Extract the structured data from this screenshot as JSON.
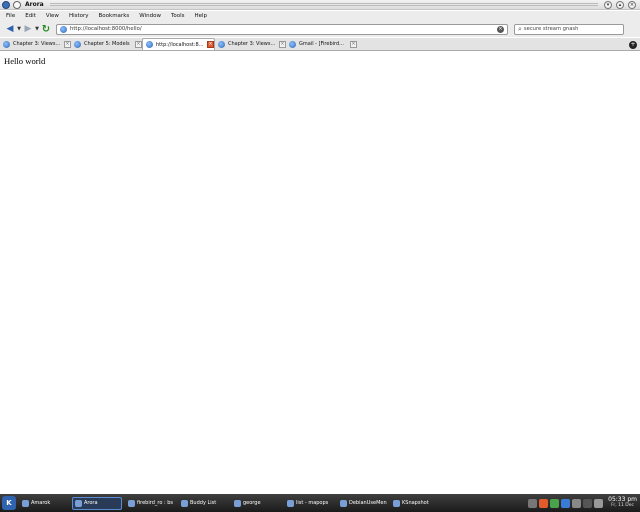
{
  "window": {
    "title": "Arora"
  },
  "menubar": {
    "items": [
      "File",
      "Edit",
      "View",
      "History",
      "Bookmarks",
      "Window",
      "Tools",
      "Help"
    ]
  },
  "navbar": {
    "url": "http://localhost:8000/hello/",
    "search_value": "secure stream gnash"
  },
  "tabs": [
    {
      "label": "Chapter 3: Views...",
      "active": false
    },
    {
      "label": "Chapter 5: Models",
      "active": false
    },
    {
      "label": "http://localhost:8...",
      "active": true
    },
    {
      "label": "Chapter 3: Views...",
      "active": false
    },
    {
      "label": "Gmail - [Firebird...",
      "active": false
    }
  ],
  "content": {
    "text": "Hello world"
  },
  "taskbar": {
    "tasks": [
      {
        "label": "Amarok",
        "active": false
      },
      {
        "label": "Arora",
        "active": true
      },
      {
        "label": "firebird_ro : bs",
        "active": false
      },
      {
        "label": "Buddy List",
        "active": false
      },
      {
        "label": "george",
        "active": false
      },
      {
        "label": "list - mapops",
        "active": false
      },
      {
        "label": "DebianUseMen",
        "active": false
      },
      {
        "label": "KSnapshot",
        "active": false
      }
    ],
    "clock": {
      "time": "05:33 pm",
      "date": "Fr, 11 Dec"
    }
  },
  "colors": {
    "accent": "#2f63b0",
    "reload": "#1e8a1e",
    "active_tab_close": "#d85b34",
    "taskbar": "#1b1b1b"
  }
}
